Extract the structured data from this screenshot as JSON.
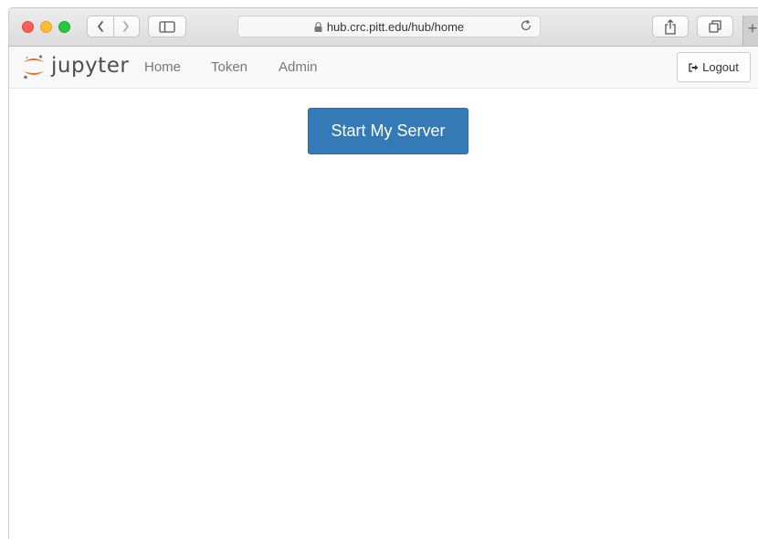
{
  "browser": {
    "url": "hub.crc.pitt.edu/hub/home",
    "icons": {
      "back": "chevron-left-icon",
      "forward": "chevron-right-icon",
      "sidebar": "sidebar-icon",
      "lock": "lock-icon",
      "reload": "reload-icon",
      "share": "share-icon",
      "tabs": "tabs-icon",
      "new_tab": "plus-icon"
    },
    "new_tab_label": "+"
  },
  "navbar": {
    "logo_text": "jupyter",
    "links": [
      {
        "label": "Home"
      },
      {
        "label": "Token"
      },
      {
        "label": "Admin"
      }
    ],
    "logout_label": "Logout"
  },
  "main": {
    "start_button_label": "Start My Server"
  },
  "colors": {
    "primary": "#337ab7",
    "jupyter_orange": "#e46e2e",
    "navbar_bg": "#f8f8f8"
  }
}
